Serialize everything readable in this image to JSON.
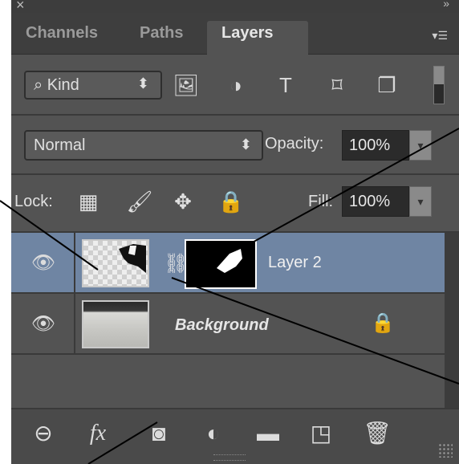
{
  "tabs": [
    {
      "label": "Channels",
      "active": false
    },
    {
      "label": "Paths",
      "active": false
    },
    {
      "label": "Layers",
      "active": true
    }
  ],
  "filter": {
    "kind_label": "Kind",
    "icons": [
      "image-filter-icon",
      "adjustment-filter-icon",
      "type-filter-icon",
      "shape-filter-icon",
      "smart-object-filter-icon"
    ]
  },
  "blend": {
    "mode": "Normal",
    "opacity_label": "Opacity:",
    "opacity_value": "100%"
  },
  "lock": {
    "label": "Lock:",
    "fill_label": "Fill:",
    "fill_value": "100%"
  },
  "layers": [
    {
      "name": "Layer 2",
      "visible": true,
      "selected": true,
      "has_mask": true
    },
    {
      "name": "Background",
      "visible": true,
      "selected": false,
      "locked": true
    }
  ],
  "bottom_icons": [
    "link-layers-icon",
    "fx-icon",
    "add-mask-icon",
    "adjustment-layer-icon",
    "new-group-icon",
    "new-layer-icon",
    "delete-layer-icon"
  ],
  "fx_label": "fx",
  "colors": {
    "panel_bg": "#535353",
    "selected_row": "#6f85a3"
  }
}
